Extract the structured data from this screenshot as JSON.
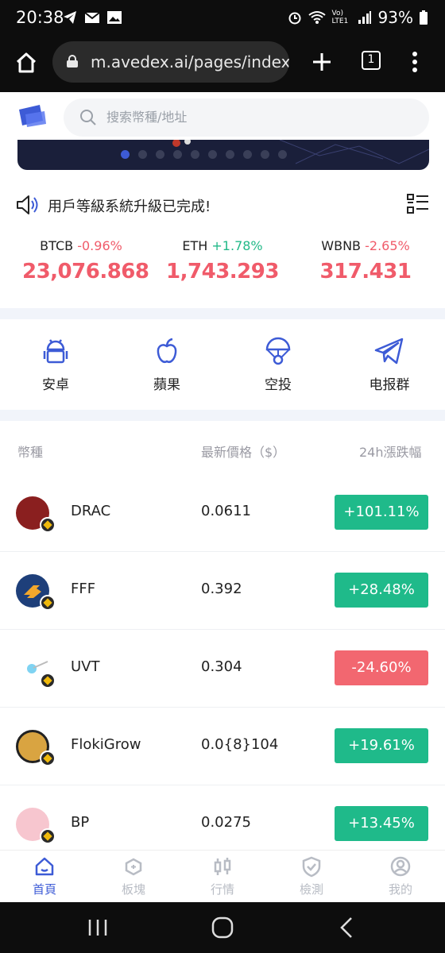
{
  "status": {
    "time": "20:38",
    "battery": "93%",
    "signal": "Vo) LTE1"
  },
  "browser": {
    "url": "m.avedex.ai/pages/index/ir",
    "tab_count": "1"
  },
  "search": {
    "placeholder": "搜索幣種/地址"
  },
  "banner": {
    "dot_count": 10,
    "active_dot": 0
  },
  "notice": {
    "text": "用戶等級系統升級已完成!"
  },
  "tickers": [
    {
      "symbol": "BTCB",
      "change": "-0.96%",
      "price": "23,076.868",
      "direction": "down"
    },
    {
      "symbol": "ETH",
      "change": "+1.78%",
      "price": "1,743.293",
      "direction": "up"
    },
    {
      "symbol": "WBNB",
      "change": "-2.65%",
      "price": "317.431",
      "direction": "down"
    }
  ],
  "quick_actions": [
    {
      "label": "安卓",
      "icon": "android-icon"
    },
    {
      "label": "蘋果",
      "icon": "apple-icon"
    },
    {
      "label": "空投",
      "icon": "airdrop-icon"
    },
    {
      "label": "电报群",
      "icon": "telegram-icon"
    }
  ],
  "table": {
    "headers": {
      "token": "幣種",
      "price": "最新價格（$）",
      "change": "24h漲跌幅"
    },
    "rows": [
      {
        "name": "DRAC",
        "price": "0.0611",
        "change": "+101.11%",
        "direction": "up",
        "logo_color": "#8a1f1f"
      },
      {
        "name": "FFF",
        "price": "0.392",
        "change": "+28.48%",
        "direction": "up",
        "logo_color": "#1e3f7a"
      },
      {
        "name": "UVT",
        "price": "0.304",
        "change": "-24.60%",
        "direction": "down",
        "logo_color": "#ffffff"
      },
      {
        "name": "FlokiGrow",
        "price": "0.0{8}104",
        "change": "+19.61%",
        "direction": "up",
        "logo_color": "#d9a441"
      },
      {
        "name": "BP",
        "price": "0.0275",
        "change": "+13.45%",
        "direction": "up",
        "logo_color": "#f7c6cf"
      }
    ]
  },
  "tabbar": [
    {
      "label": "首頁",
      "active": true
    },
    {
      "label": "板塊",
      "active": false
    },
    {
      "label": "行情",
      "active": false
    },
    {
      "label": "檢測",
      "active": false
    },
    {
      "label": "我的",
      "active": false
    }
  ],
  "colors": {
    "accent": "#3d5bd6",
    "up": "#1fba8a",
    "down": "#f26770"
  }
}
